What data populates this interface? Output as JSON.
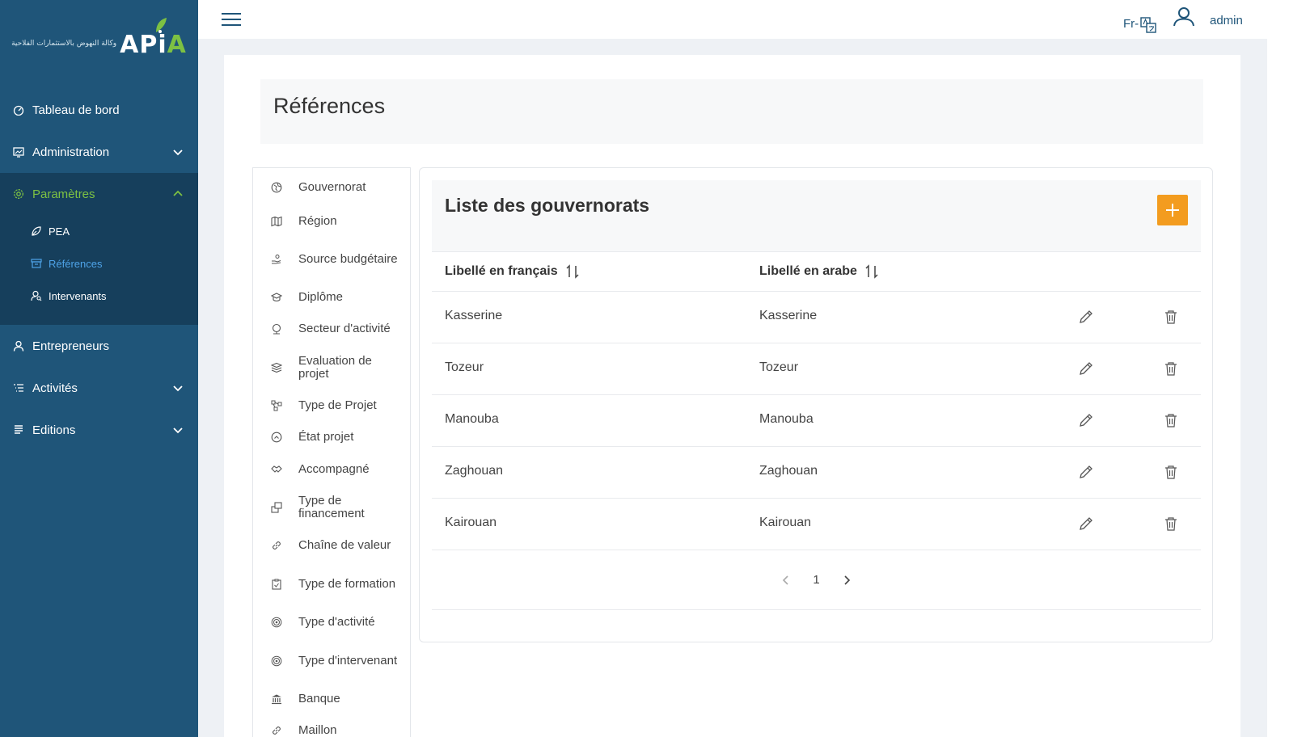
{
  "logo": {
    "arabic": "وكالة النهوض بالاستثمارات الفلاحية",
    "word_a": "APi",
    "word_b": "A"
  },
  "sidebar": {
    "items": [
      {
        "label": "Tableau de bord",
        "icon": "gauge-icon"
      },
      {
        "label": "Administration",
        "icon": "monitor-icon"
      },
      {
        "label": "Paramètres",
        "icon": "gear-icon"
      },
      {
        "label": "Entrepreneurs",
        "icon": "user-icon"
      },
      {
        "label": "Activités",
        "icon": "list-icon"
      },
      {
        "label": "Editions",
        "icon": "document-icon"
      }
    ],
    "subitems": [
      {
        "label": "PEA",
        "icon": "leaf-icon"
      },
      {
        "label": "Références",
        "icon": "archive-icon"
      },
      {
        "label": "Intervenants",
        "icon": "user-search-icon"
      }
    ]
  },
  "topbar": {
    "lang": "Fr-",
    "user": "admin"
  },
  "page": {
    "title": "Références"
  },
  "refmenu": [
    {
      "label": "Gouvernorat",
      "icon": "globe-icon"
    },
    {
      "label": "Région",
      "icon": "map-icon"
    },
    {
      "label": "Source budgétaire",
      "icon": "hand-coin-icon"
    },
    {
      "label": "Diplôme",
      "icon": "graduation-icon"
    },
    {
      "label": "Secteur d'activité",
      "icon": "industry-icon"
    },
    {
      "label": "Evaluation de projet",
      "icon": "layers-icon"
    },
    {
      "label": "Type de Projet",
      "icon": "nodes-icon"
    },
    {
      "label": "État projet",
      "icon": "chevron-circle-icon"
    },
    {
      "label": "Accompagné",
      "icon": "handshake-icon"
    },
    {
      "label": "Type de financement",
      "icon": "money-icon"
    },
    {
      "label": "Chaîne de valeur",
      "icon": "link-icon"
    },
    {
      "label": "Type de formation",
      "icon": "clipboard-icon"
    },
    {
      "label": "Type d'activité",
      "icon": "target-icon"
    },
    {
      "label": "Type d'intervenant",
      "icon": "target-icon"
    },
    {
      "label": "Banque",
      "icon": "bank-icon"
    },
    {
      "label": "Maillon",
      "icon": "link-icon"
    }
  ],
  "list": {
    "title": "Liste des gouvernorats",
    "columns": [
      "Libellé en français",
      "Libellé en arabe"
    ],
    "rows": [
      {
        "fr": "Kasserine",
        "ar": "Kasserine"
      },
      {
        "fr": "Tozeur",
        "ar": "Tozeur"
      },
      {
        "fr": "Manouba",
        "ar": "Manouba"
      },
      {
        "fr": "Zaghouan",
        "ar": "Zaghouan"
      },
      {
        "fr": "Kairouan",
        "ar": "Kairouan"
      }
    ],
    "page": "1"
  },
  "colors": {
    "sidebar": "#1f5579",
    "sidebar_open": "#163f5c",
    "accent_green": "#7dc143",
    "active_blue": "#4ea3e8",
    "add_button": "#f39c1f"
  }
}
